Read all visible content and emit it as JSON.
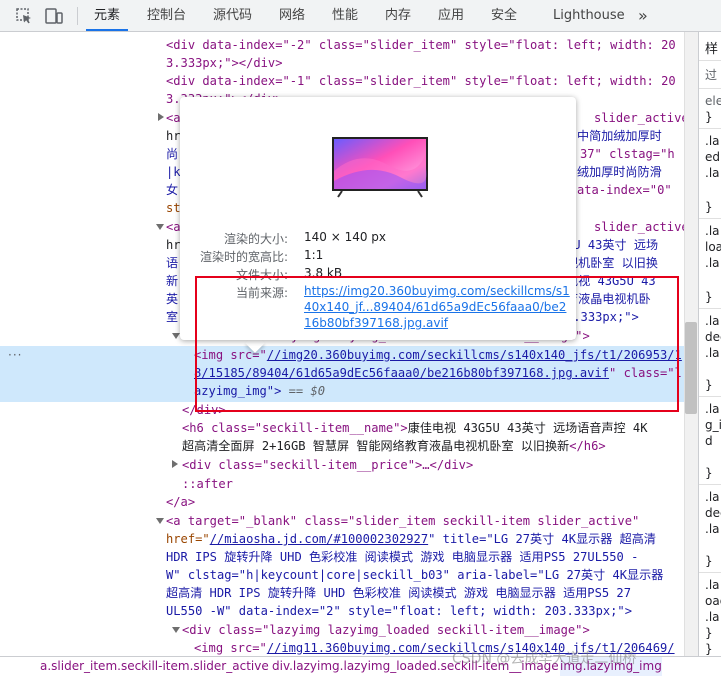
{
  "tabs": {
    "elements": "元素",
    "console": "控制台",
    "sources": "源代码",
    "network": "网络",
    "performance": "性能",
    "memory": "内存",
    "application": "应用",
    "security": "安全",
    "lighthouse": "Lighthouse",
    "more": "»"
  },
  "code": {
    "l1": "<div data-index=\"-2\" class=\"slider_item\" style=\"float: left; width: 20",
    "l2": "3.333px;\"></div>",
    "l3": "<div data-index=\"-1\" class=\"slider_item\" style=\"float: left; width: 20",
    "l4": "3.333px;\"></div>",
    "l5a": "<a",
    "l5b": "slider_active\"",
    "l6a": "hr",
    "l6b": "中简加绒加厚时",
    "l7a": "尚",
    "l7b": "37\" clstag=\"h",
    "l8a": "|k",
    "l8b": "绒加厚时尚防滑",
    "l9a": "女",
    "l9b": "ata-index=\"0\"",
    "l10a": "st",
    "l11a": "<a",
    "l11b": "slider_active\"",
    "l12a": "hr",
    "l12b": "5U 43英寸 远场",
    "l13a": "语",
    "l13b": "视机卧室 以旧换",
    "l14a": "新",
    "l14b": "电视 43G5U 43",
    "l15a": "英",
    "l15b": "育液晶电视机卧",
    "l16a": "室",
    "l16b": "3.333px;\">",
    "l17": "<div class=\"lazyimg lazyimg_loaded seckill-item__image\">",
    "sel1a": "<img src=\"",
    "sel1b": "//img20.360buyimg.com/seckillcms/s140x140_jfs/t1/206953/1",
    "sel2a": "8/15185/89404/61d65a9dEc56faaa0/be216b80bf397168.jpg.avif",
    "sel2b": "\" class=\"l",
    "sel3a": "azyimg_img\">",
    "sel3b": " == $0",
    "l18": "</div>",
    "l19a": "<h6 class=\"seckill-item__name\">",
    "l19b": "康佳电视 43G5U 43英寸 远场语音声控 4K",
    "l20a": "超高清全面屏 2+16GB 智慧屏 智能网络教育液晶电视机卧室 以旧换新",
    "l20b": "</h6>",
    "l21": "<div class=\"seckill-item__price\">…</div>",
    "l22": "::after",
    "l23": "</a>",
    "l24": "<a target=\"_blank\" class=\"slider_item seckill-item slider_active\"",
    "l25a": "href=\"",
    "l25b": "//miaosha.jd.com/#100002302927",
    "l25c": "\" title=\"LG 27英寸 4K显示器 超高清",
    "l26": "HDR IPS 旋转升降 UHD 色彩校准 阅读模式 游戏 电脑显示器 适用PS5 27UL550 -",
    "l27": "W\" clstag=\"h|keycount|core|seckill_b03\" aria-label=\"LG 27英寸 4K显示器",
    "l28": "超高清 HDR IPS 旋转升降 UHD 色彩校准 阅读模式 游戏 电脑显示器 适用PS5 27",
    "l29": "UL550 -W\" data-index=\"2\" style=\"float: left; width: 203.333px;\">",
    "l30": "<div class=\"lazyimg lazyimg_loaded seckill-item__image\">",
    "l31a": "<img src=\"",
    "l31b": "//img11.360buyimg.com/seckillcms/s140x140_jfs/t1/206469/"
  },
  "tooltip": {
    "rendered_size_label": "渲染的大小:",
    "rendered_size_value": "140 × 140 px",
    "aspect_label": "渲染时的宽高比:",
    "aspect_value": "1:1",
    "file_size_label": "文件大小:",
    "file_size_value": "3.8 kB",
    "source_label": "当前来源:",
    "source_value": "https://img20.360buyimg.com/seckillcms/s140x140_jf...89404/61d65a9dEc56faaa0/be216b80bf397168.jpg.avif"
  },
  "styles_pane": {
    "tab": "样",
    "filter": "过",
    "r1": "ele",
    "r2": "}",
    "r3": ".la",
    "r4": "ed",
    "r5": ".la",
    "r6": "}",
    "r7": ".la",
    "r8": "loa",
    "r9": ".la",
    "r10": "}",
    "r11": ".la",
    "r12": "dec",
    "r13": ".la",
    "r14": "}",
    "r15": ".la",
    "r16": "g_i",
    "r17": "d",
    "r18": "}",
    "r19": ".la",
    "r20": "dec",
    "r21": ".la",
    "r22": "}",
    "r23": ".la",
    "r24": "oad",
    "r25": ".la",
    "r26": "}",
    "r27": "}"
  },
  "breadcrumb": {
    "c1": "a.slider_item.seckill-item.slider_active",
    "c2": "div.lazyimg.lazyimg_loaded.seckill-item__image",
    "c3": "img.lazyimg_img"
  },
  "watermark": "CSDN @去成华大道走二仙桥",
  "colors": {
    "accent": "#1a73e8",
    "selection": "#cfe8fc",
    "highlight_box": "#e5001b",
    "tag": "#881280",
    "attribute": "#994500",
    "value": "#1a1aa6"
  }
}
